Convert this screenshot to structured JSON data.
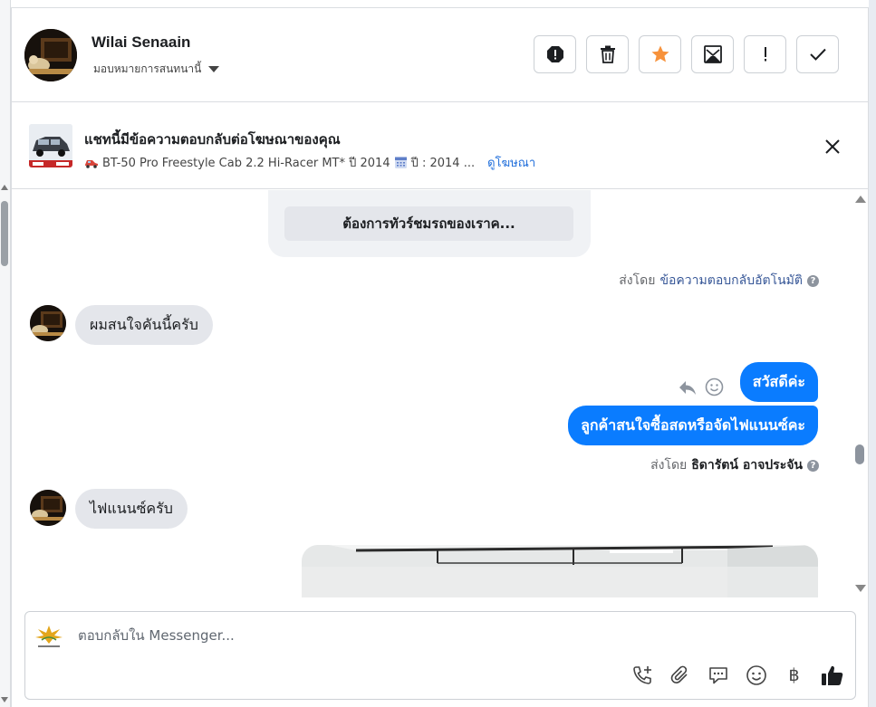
{
  "header": {
    "name": "Wilai Senaain",
    "assign_label": "มอบหมายการสนทนานี้",
    "actions": [
      {
        "icon": "report-icon"
      },
      {
        "icon": "trash-icon"
      },
      {
        "icon": "star-icon"
      },
      {
        "icon": "envelope-icon"
      },
      {
        "icon": "exclamation-icon"
      },
      {
        "icon": "check-icon"
      }
    ]
  },
  "ad": {
    "title": "แชทนี้มีข้อความตอบกลับต่อโฆษณาของคุณ",
    "detail": "BT-50 Pro Freestyle Cab 2.2 Hi-Racer MT* ปี 2014",
    "year": "ปี : 2014 ...",
    "link": "ดูโฆษณา"
  },
  "conversation": {
    "card_button": "ต้องการทัวร์ชมรถของเราค...",
    "auto_sent_prefix": "ส่งโดย",
    "auto_sent_by": "ข้อความตอบกลับอัตโนมัติ",
    "msg1": "ผมสนใจคันนี้ครับ",
    "msg2": "สวัสดีค่ะ",
    "msg3": "ลูกค้าสนใจซื้อสดหรือจัดไฟแนนซ์คะ",
    "sent_prefix": "ส่งโดย",
    "sent_by": "ธิดารัตน์ อาจประจัน",
    "msg4": "ไฟแนนซ์ครับ"
  },
  "composer": {
    "placeholder": "ตอบกลับใน Messenger...",
    "baht_symbol": "฿"
  },
  "colors": {
    "accent": "#0a7cff",
    "star": "#f7923b",
    "link": "#216fdb"
  }
}
